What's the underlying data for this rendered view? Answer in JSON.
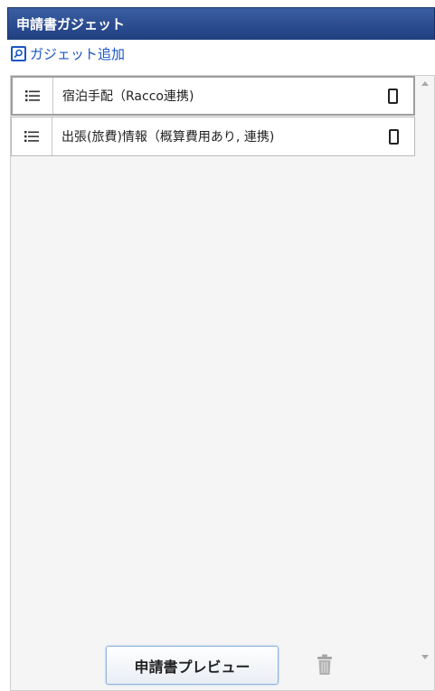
{
  "title": "申請書ガジェット",
  "add_gadget_label": "ガジェット追加",
  "gadgets": [
    {
      "label": "宿泊手配（Racco連携)"
    },
    {
      "label": "出張(旅費)情報（概算費用あり, 連携)"
    }
  ],
  "preview_button_label": "申請書プレビュー",
  "colors": {
    "header": "#2b4f95",
    "link": "#1a56c4"
  },
  "icons": [
    "search-icon",
    "drag-handle-icon",
    "mobile-icon",
    "trash-icon"
  ]
}
